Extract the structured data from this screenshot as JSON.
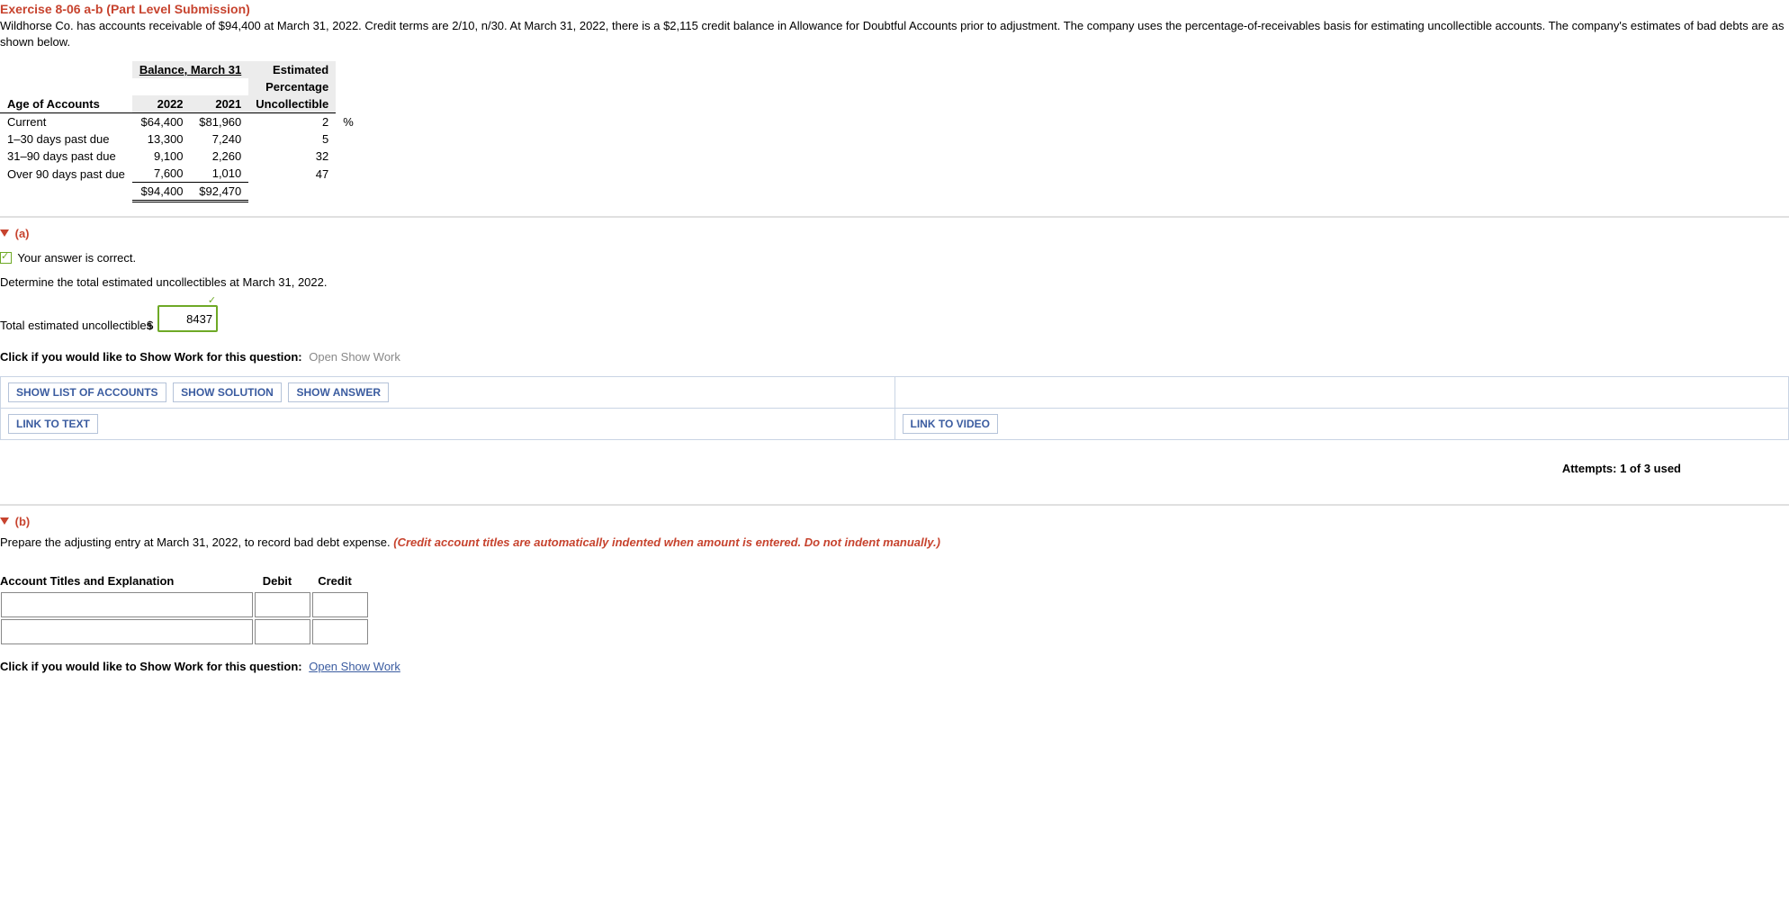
{
  "header": {
    "title": "Exercise 8-06 a-b (Part Level Submission)",
    "problem": "Wildhorse Co. has accounts receivable of $94,400 at March 31, 2022. Credit terms are 2/10, n/30. At March 31, 2022, there is a $2,115 credit balance in Allowance for Doubtful Accounts prior to adjustment. The company uses the percentage-of-receivables basis for estimating uncollectible accounts. The company's estimates of bad debts are as shown below."
  },
  "table": {
    "balance_header": "Balance, March 31",
    "age_header": "Age of Accounts",
    "y2022": "2022",
    "y2021": "2021",
    "pct_header1": "Estimated",
    "pct_header2": "Percentage",
    "pct_header3": "Uncollectible",
    "rows": [
      {
        "age": "Current",
        "b22": "$64,400",
        "b21": "$81,960",
        "pct": "2",
        "unit": "%"
      },
      {
        "age": "1–30 days past due",
        "b22": "13,300",
        "b21": "7,240",
        "pct": "5",
        "unit": ""
      },
      {
        "age": "31–90 days past due",
        "b22": "9,100",
        "b21": "2,260",
        "pct": "32",
        "unit": ""
      },
      {
        "age": "Over 90 days past due",
        "b22": "7,600",
        "b21": "1,010",
        "pct": "47",
        "unit": ""
      }
    ],
    "total22": "$94,400",
    "total21": "$92,470"
  },
  "partA": {
    "label": "(a)",
    "correct_msg": "Your answer is correct.",
    "instruction": "Determine the total estimated uncollectibles at March 31, 2022.",
    "answer_label": "Total estimated uncollectibles",
    "currency": "$",
    "answer_value": "8437",
    "show_work_prefix": "Click if you would like to Show Work for this question:",
    "show_work_link": "Open Show Work"
  },
  "actions": {
    "list": "SHOW LIST OF ACCOUNTS",
    "solution": "SHOW SOLUTION",
    "answer": "SHOW ANSWER",
    "text": "LINK TO TEXT",
    "video": "LINK TO VIDEO"
  },
  "attempts": "Attempts: 1 of 3 used",
  "partB": {
    "label": "(b)",
    "instruction_a": "Prepare the adjusting entry at March 31, 2022, to record bad debt expense. ",
    "instruction_b": "(Credit account titles are automatically indented when amount is entered. Do not indent manually.)",
    "col1": "Account Titles and Explanation",
    "col2": "Debit",
    "col3": "Credit",
    "show_work_prefix": "Click if you would like to Show Work for this question:",
    "show_work_link": "Open Show Work"
  }
}
